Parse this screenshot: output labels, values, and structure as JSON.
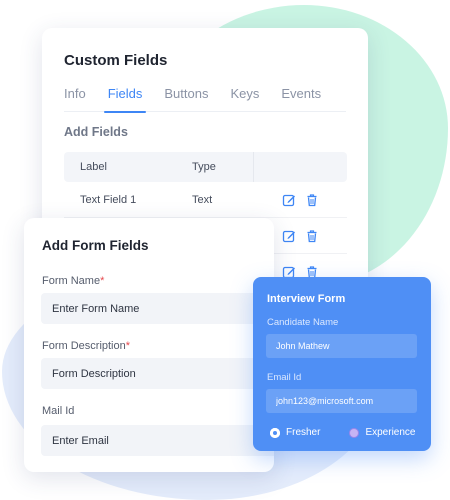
{
  "colors": {
    "accent": "#3e86f5",
    "interview_card": "#4f8ff5",
    "green_blob": "#c9f4e3",
    "blue_blob": "#e4ecfb",
    "required_mark": "#e5484d"
  },
  "custom_fields": {
    "title": "Custom Fields",
    "tabs": [
      {
        "label": "Info",
        "active": false
      },
      {
        "label": "Fields",
        "active": true
      },
      {
        "label": "Buttons",
        "active": false
      },
      {
        "label": "Keys",
        "active": false
      },
      {
        "label": "Events",
        "active": false
      }
    ],
    "section_label": "Add Fields",
    "table": {
      "columns": [
        "Label",
        "Type"
      ],
      "rows": [
        {
          "label": "Text Field 1",
          "type": "Text",
          "actions": [
            "edit-icon",
            "trash-icon"
          ]
        },
        {
          "label": "",
          "type": "",
          "actions": [
            "edit-icon",
            "trash-icon"
          ]
        },
        {
          "label": "",
          "type": "",
          "actions": [
            "edit-icon",
            "trash-icon"
          ]
        }
      ]
    }
  },
  "add_form_fields": {
    "title": "Add Form Fields",
    "fields": [
      {
        "label": "Form Name",
        "required": "*",
        "placeholder": "Enter Form Name"
      },
      {
        "label": "Form Description",
        "required": "*",
        "placeholder": "Form Description"
      },
      {
        "label": "Mail Id",
        "required": "",
        "placeholder": "Enter Email"
      }
    ]
  },
  "interview_form": {
    "title": "Interview Form",
    "candidate_label": "Candidate Name",
    "candidate_value": "John Mathew",
    "email_label": "Email Id",
    "email_value": "john123@microsoft.com",
    "options": [
      {
        "label": "Fresher",
        "selected": true
      },
      {
        "label": "Experience",
        "selected": false
      }
    ]
  }
}
